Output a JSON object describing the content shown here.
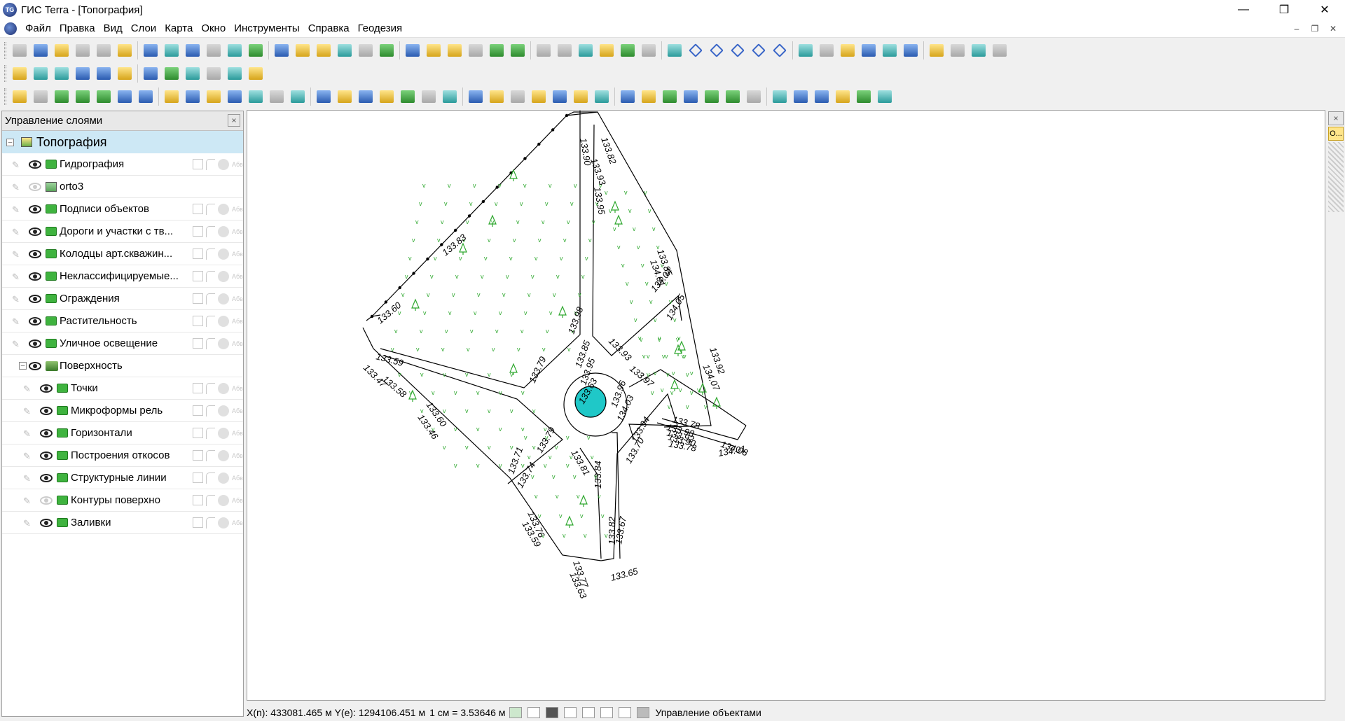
{
  "window": {
    "title": "ГИС Terra - [Топография]",
    "logo_text": "TG"
  },
  "menu": [
    "Файл",
    "Правка",
    "Вид",
    "Слои",
    "Карта",
    "Окно",
    "Инструменты",
    "Справка",
    "Геодезия"
  ],
  "toolbar_icons": {
    "row1": [
      "new-map-icon",
      "open-icon",
      "grid-icon",
      "import-icon",
      "save-icon",
      "cut-icon",
      "copy-icon",
      "paste-icon",
      "print-icon",
      "undo-icon",
      "redo-icon",
      "pan-hand-icon",
      "select-arrow-icon",
      "polygon-icon",
      "label-icon",
      "layer-add-icon",
      "table-icon",
      "layers-icon",
      "layer-edit-icon",
      "layer-tool-icon",
      "pin-icon",
      "shape-icon",
      "shape2-icon",
      "text-icon",
      "rectangle-icon",
      "ellipse-icon",
      "map-add-icon",
      "map2-icon",
      "map3-icon",
      "map4-icon",
      "map5-icon",
      "node-icon",
      "node2-icon",
      "node3-icon",
      "node4-icon",
      "node5-icon",
      "measure-icon",
      "measure2-icon",
      "surface-icon",
      "arc-icon",
      "arc2-icon",
      "arc3-icon",
      "arc4-icon",
      "target-icon",
      "volume-icon",
      "m3-icon"
    ],
    "row2": [
      "triangle-icon",
      "circles-icon",
      "angle-icon",
      "cross-icon",
      "perpendicular-icon",
      "parallelogram-icon",
      "tick-icon",
      "circle-icon",
      "arc-tool-icon",
      "cube-icon",
      "mesh-icon",
      "export-icon"
    ],
    "row3": [
      "pie-icon",
      "point-icon",
      "point-label-icon",
      "point-num-icon",
      "point-circle-icon",
      "point-arrow-icon",
      "point-add-icon",
      "point-del-icon",
      "point-find-icon",
      "point-move-icon",
      "point-split-icon",
      "contour-icon",
      "contour2-icon",
      "contour3-icon",
      "contour4-icon",
      "tin-icon",
      "tin2-icon",
      "tin3-icon",
      "tin4-icon",
      "tin5-icon",
      "tin6-icon",
      "tin7-icon",
      "tin8-icon",
      "layer-stack-icon",
      "slope-icon",
      "slope2-icon",
      "slope3-icon",
      "check-icon",
      "view1-icon",
      "view2-icon",
      "view3-icon",
      "grid-view-icon",
      "window-icon",
      "tile-icon",
      "page-icon",
      "info-icon",
      "disk-icon",
      "layers2-icon",
      "export2-icon",
      "export3-icon",
      "calc-icon"
    ]
  },
  "layer_panel": {
    "title": "Управление слоями",
    "close": "×",
    "root": "Топография",
    "layers": [
      {
        "label": "Гидрография",
        "visible": true,
        "kind": "folder",
        "indent": 0
      },
      {
        "label": "orto3",
        "visible": false,
        "kind": "raster",
        "indent": 0
      },
      {
        "label": "Подписи объектов",
        "visible": true,
        "kind": "folder",
        "indent": 0
      },
      {
        "label": "Дороги и участки с тв...",
        "visible": true,
        "kind": "folder",
        "indent": 0
      },
      {
        "label": "Колодцы арт.скважин...",
        "visible": true,
        "kind": "folder",
        "indent": 0
      },
      {
        "label": "Неклассифицируемые...",
        "visible": true,
        "kind": "folder",
        "indent": 0
      },
      {
        "label": "Ограждения",
        "visible": true,
        "kind": "folder",
        "indent": 0
      },
      {
        "label": "Растительность",
        "visible": true,
        "kind": "folder",
        "indent": 0
      },
      {
        "label": "Уличное освещение",
        "visible": true,
        "kind": "folder",
        "indent": 0
      },
      {
        "label": "Поверхность",
        "visible": true,
        "kind": "surface",
        "indent": 0
      },
      {
        "label": "Точки",
        "visible": true,
        "kind": "folder",
        "indent": 1
      },
      {
        "label": "Микроформы рель",
        "visible": true,
        "kind": "folder",
        "indent": 1
      },
      {
        "label": "Горизонтали",
        "visible": true,
        "kind": "folder",
        "indent": 1
      },
      {
        "label": "Построения откосов",
        "visible": true,
        "kind": "folder",
        "indent": 1
      },
      {
        "label": "Структурные линии",
        "visible": true,
        "kind": "folder",
        "indent": 1
      },
      {
        "label": "Контуры поверхно",
        "visible": false,
        "kind": "folder",
        "indent": 1
      },
      {
        "label": "Заливки",
        "visible": true,
        "kind": "folder",
        "indent": 1
      }
    ],
    "abbrev": "Абв"
  },
  "map": {
    "elevations": [
      "133.90",
      "133.82",
      "133.93",
      "133.95",
      "133.85",
      "134.01",
      "133.83",
      "134.04",
      "134.05",
      "133.60",
      "133.98",
      "133.93",
      "133.92",
      "134.07",
      "133.59",
      "133.47",
      "133.58",
      "133.79",
      "133.85",
      "133.95",
      "133.97",
      "133.63",
      "133.96",
      "134.03",
      "133.78",
      "133.90",
      "133.98",
      "133.92",
      "133.78",
      "134.08",
      "134.01",
      "133.60",
      "133.46",
      "133.94",
      "133.79",
      "133.81",
      "133.70",
      "133.71",
      "133.74",
      "133.84",
      "133.76",
      "133.59",
      "133.82",
      "133.67",
      "133.77",
      "133.63",
      "133.65"
    ],
    "colors": {
      "line": "#000000",
      "vegetation": "#2fa82f",
      "fill": "#1fc8c8"
    }
  },
  "status": {
    "coords": "X(n): 433081.465 м Y(e): 1294106.451 м",
    "scale": "1 см = 3.53646 м",
    "mode": "Управление объектами"
  },
  "right_dock": {
    "close": "×",
    "tab": "O..."
  }
}
